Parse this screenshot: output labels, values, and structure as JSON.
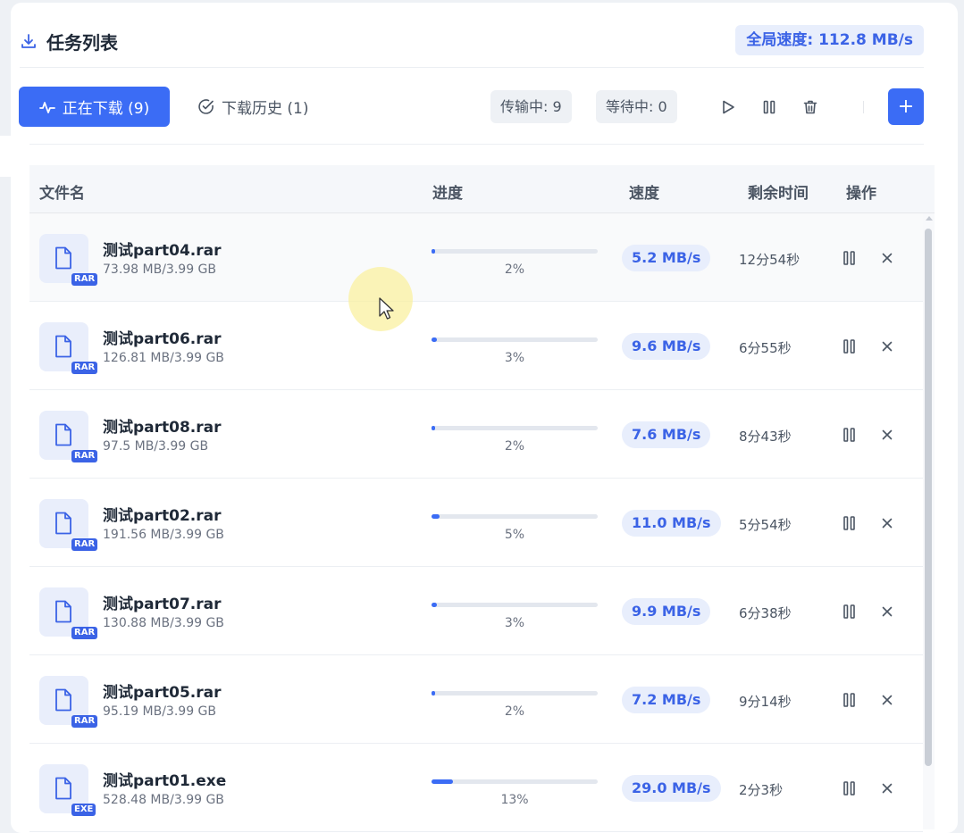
{
  "header": {
    "title": "任务列表",
    "title_icon": "download-icon",
    "global_speed": "全局速度: 112.8 MB/s"
  },
  "toolbar": {
    "tab_downloading": "正在下载 (9)",
    "tab_history": "下载历史 (1)",
    "transferring": "传输中: 9",
    "waiting": "等待中: 0",
    "add_label": "+"
  },
  "table": {
    "headers": {
      "filename": "文件名",
      "progress": "进度",
      "speed": "速度",
      "remaining": "剩余时间",
      "actions": "操作"
    },
    "rows": [
      {
        "name": "测试part04.rar",
        "size": "73.98 MB/3.99 GB",
        "ext": "RAR",
        "progress": 2,
        "progress_label": "2%",
        "speed": "5.2 MB/s",
        "remaining": "12分54秒"
      },
      {
        "name": "测试part06.rar",
        "size": "126.81 MB/3.99 GB",
        "ext": "RAR",
        "progress": 3,
        "progress_label": "3%",
        "speed": "9.6 MB/s",
        "remaining": "6分55秒"
      },
      {
        "name": "测试part08.rar",
        "size": "97.5 MB/3.99 GB",
        "ext": "RAR",
        "progress": 2,
        "progress_label": "2%",
        "speed": "7.6 MB/s",
        "remaining": "8分43秒"
      },
      {
        "name": "测试part02.rar",
        "size": "191.56 MB/3.99 GB",
        "ext": "RAR",
        "progress": 5,
        "progress_label": "5%",
        "speed": "11.0 MB/s",
        "remaining": "5分54秒"
      },
      {
        "name": "测试part07.rar",
        "size": "130.88 MB/3.99 GB",
        "ext": "RAR",
        "progress": 3,
        "progress_label": "3%",
        "speed": "9.9 MB/s",
        "remaining": "6分38秒"
      },
      {
        "name": "测试part05.rar",
        "size": "95.19 MB/3.99 GB",
        "ext": "RAR",
        "progress": 2,
        "progress_label": "2%",
        "speed": "7.2 MB/s",
        "remaining": "9分14秒"
      },
      {
        "name": "测试part01.exe",
        "size": "528.48 MB/3.99 GB",
        "ext": "EXE",
        "progress": 13,
        "progress_label": "13%",
        "speed": "29.0 MB/s",
        "remaining": "2分3秒"
      }
    ]
  },
  "colors": {
    "accent": "#3b6cf5",
    "accent_text": "#3b63e6",
    "accent_soft": "#e8eefc"
  }
}
